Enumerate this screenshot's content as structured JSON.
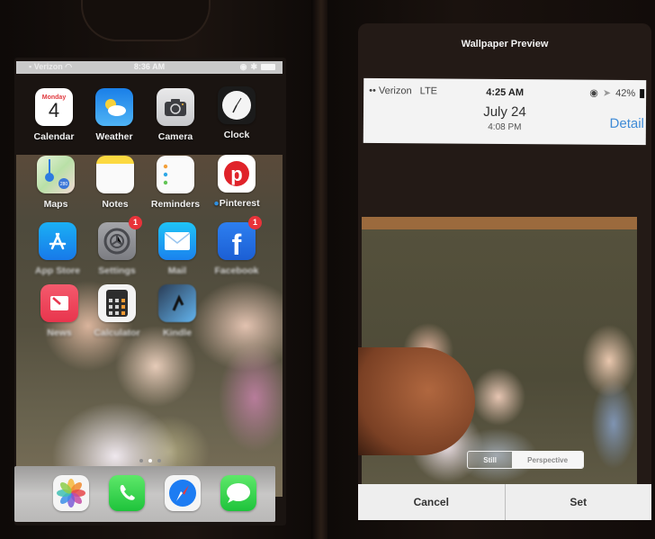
{
  "left_phone": {
    "status_bar": {
      "carrier": "Verizon",
      "time": "8:36 AM",
      "icons": [
        "signal-icon",
        "wifi-icon",
        "rotation-lock-icon",
        "bluetooth-icon",
        "battery-icon"
      ]
    },
    "apps": [
      {
        "name": "Calendar",
        "label": "Calendar",
        "icon": "calendar-icon",
        "day": "Monday",
        "date": "4"
      },
      {
        "name": "Weather",
        "label": "Weather",
        "icon": "weather-icon"
      },
      {
        "name": "Camera",
        "label": "Camera",
        "icon": "camera-icon"
      },
      {
        "name": "Clock",
        "label": "Clock",
        "icon": "clock-icon"
      },
      {
        "name": "Maps",
        "label": "Maps",
        "icon": "maps-icon"
      },
      {
        "name": "Notes",
        "label": "Notes",
        "icon": "notes-icon"
      },
      {
        "name": "Reminders",
        "label": "Reminders",
        "icon": "reminders-icon"
      },
      {
        "name": "Pinterest",
        "label": "Pinterest",
        "icon": "pinterest-icon",
        "new_dot": true
      },
      {
        "name": "App Store",
        "label": "App Store",
        "icon": "app-store-icon"
      },
      {
        "name": "Settings",
        "label": "Settings",
        "icon": "settings-icon",
        "badge": "1"
      },
      {
        "name": "Mail",
        "label": "Mail",
        "icon": "mail-icon"
      },
      {
        "name": "Facebook",
        "label": "Facebook",
        "icon": "facebook-icon",
        "badge": "1"
      },
      {
        "name": "News",
        "label": "News",
        "icon": "news-icon"
      },
      {
        "name": "Calculator",
        "label": "Calculator",
        "icon": "calculator-icon"
      },
      {
        "name": "Kindle",
        "label": "Kindle",
        "icon": "kindle-icon"
      }
    ],
    "page_indicator": {
      "pages": 3,
      "current": 2
    },
    "dock": [
      {
        "name": "Photos",
        "icon": "photos-icon"
      },
      {
        "name": "Phone",
        "icon": "phone-icon"
      },
      {
        "name": "Safari",
        "icon": "safari-icon"
      },
      {
        "name": "Messages",
        "icon": "messages-icon"
      }
    ]
  },
  "right_phone": {
    "title": "Wallpaper Preview",
    "lock_preview": {
      "carrier": "Verizon",
      "network": "LTE",
      "time": "4:25 AM",
      "battery": "42%",
      "date": "July 24",
      "sub_time": "4:08 PM",
      "detail_link": "Detail"
    },
    "segmented_control": {
      "options": [
        "Still",
        "Perspective"
      ],
      "selected": "Perspective"
    },
    "buttons": {
      "cancel": "Cancel",
      "set": "Set"
    }
  },
  "colors": {
    "badge_red": "#e8333a",
    "detail_link_blue": "#3d8ad6",
    "dock_gray": "#c8c7c6"
  }
}
